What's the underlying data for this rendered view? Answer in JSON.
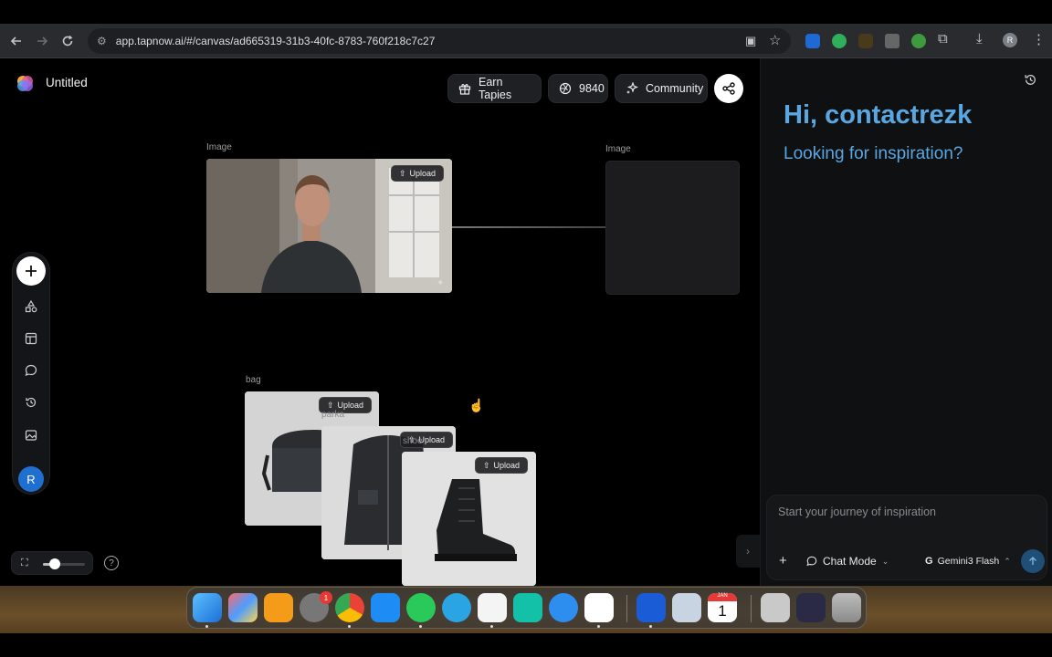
{
  "browser": {
    "url": "app.tapnow.ai/#/canvas/ad665319-31b3-40fc-8783-760f218c7c27",
    "profile_initial": "R"
  },
  "app": {
    "title": "Untitled",
    "earn_label": "Earn Tapies",
    "credits": "9840",
    "community_label": "Community"
  },
  "sidebar": {
    "avatar_initial": "R"
  },
  "canvas": {
    "node1_label": "Image",
    "node2_label": "Image",
    "bag_label": "bag",
    "parka_label": "parka",
    "shoe_label": "shoe",
    "upload_label": "Upload"
  },
  "chat": {
    "greeting": "Hi, contactrezk",
    "subtitle": "Looking for inspiration?",
    "placeholder": "Start your journey of inspiration",
    "mode_label": "Chat Mode",
    "model_label": "Gemini3 Flash"
  },
  "dock": {
    "badge_count": "1",
    "calendar_month": "JAN",
    "calendar_day": "1"
  },
  "colors": {
    "accent_blue": "#5aa6e0",
    "avatar_blue": "#1f6fd1"
  }
}
